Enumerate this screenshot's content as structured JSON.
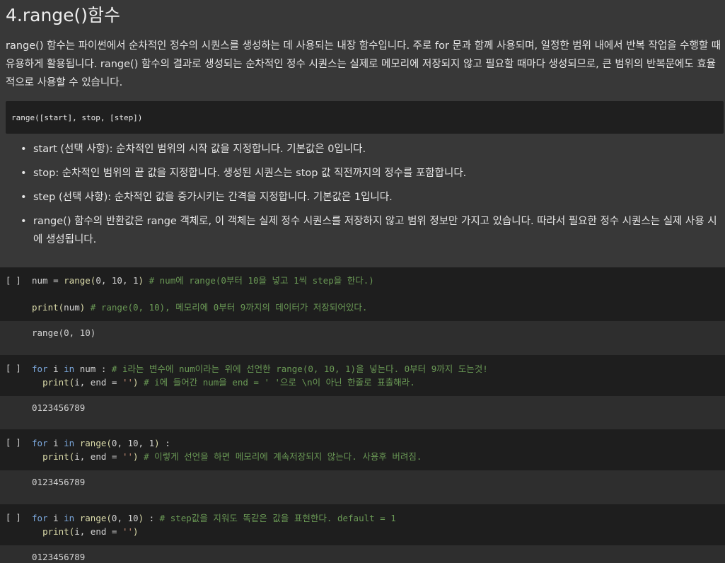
{
  "title": "4.range()함수",
  "intro": "range() 함수는 파이썬에서 순차적인 정수의 시퀀스를 생성하는 데 사용되는 내장 함수입니다. 주로 for 문과 함께 사용되며, 일정한 범위 내에서 반복 작업을 수행할 때 유용하게 활용됩니다. range() 함수의 결과로 생성되는 순차적인 정수 시퀀스는 실제로 메모리에 저장되지 않고 필요할 때마다 생성되므로, 큰 범위의 반복문에도 효율적으로 사용할 수 있습니다.",
  "syntax": "range([start], stop, [step])",
  "bullets": [
    "start (선택 사항): 순차적인 범위의 시작 값을 지정합니다. 기본값은 0입니다.",
    "stop: 순차적인 범위의 끝 값을 지정합니다. 생성된 시퀀스는 stop 값 직전까지의 정수를 포함합니다.",
    "step (선택 사항): 순차적인 값을 증가시키는 간격을 지정합니다. 기본값은 1입니다.",
    "range() 함수의 반환값은 range 객체로, 이 객체는 실제 정수 시퀀스를 저장하지 않고 범위 정보만 가지고 있습니다. 따라서 필요한 정수 시퀀스는 실제 사용 시에 생성됩니다."
  ],
  "cells": [
    {
      "prompt": "[ ]",
      "code": [
        [
          [
            "num = ",
            ""
          ],
          [
            "range",
            "fn"
          ],
          [
            "(",
            "fn"
          ],
          [
            "0, 10, 1",
            ""
          ],
          [
            ")",
            "fn"
          ],
          [
            " # num에 range(0부터 10을 넣고 1씩 step을 한다.)",
            "cm"
          ]
        ],
        [
          [
            "",
            ""
          ]
        ],
        [
          [
            "print",
            "fn"
          ],
          [
            "(",
            "fn"
          ],
          [
            "num",
            ""
          ],
          [
            ")",
            "fn"
          ],
          [
            " # range(0, 10), 메모리에 0부터 9까지의 데이터가 저장되어있다.",
            "cm"
          ]
        ]
      ],
      "output": "range(0, 10)"
    },
    {
      "prompt": "[ ]",
      "code": [
        [
          [
            "for",
            "kw"
          ],
          [
            " i ",
            ""
          ],
          [
            "in",
            "kw"
          ],
          [
            " num : ",
            ""
          ],
          [
            "# i라는 변수에 num이라는 위에 선언한 range(0, 10, 1)을 넣는다. 0부터 9까지 도는것!",
            "cm"
          ]
        ],
        [
          [
            "  ",
            ""
          ],
          [
            "print",
            "fn"
          ],
          [
            "(",
            "fn"
          ],
          [
            "i, end = ",
            ""
          ],
          [
            "''",
            "st"
          ],
          [
            ")",
            "fn"
          ],
          [
            " # i에 들어간 num을 end = ' '으로 \\n이 아닌 한줄로 표출해라.",
            "cm"
          ]
        ]
      ],
      "output": "0123456789"
    },
    {
      "prompt": "[ ]",
      "code": [
        [
          [
            "for",
            "kw"
          ],
          [
            " i ",
            ""
          ],
          [
            "in",
            "kw"
          ],
          [
            " ",
            ""
          ],
          [
            "range",
            "fn"
          ],
          [
            "(",
            "fn"
          ],
          [
            "0, 10, 1",
            ""
          ],
          [
            ")",
            "fn"
          ],
          [
            " :",
            ""
          ]
        ],
        [
          [
            "  ",
            ""
          ],
          [
            "print",
            "fn"
          ],
          [
            "(",
            "fn"
          ],
          [
            "i, end = ",
            ""
          ],
          [
            "''",
            "st"
          ],
          [
            ")",
            "fn"
          ],
          [
            " # 이렇게 선언을 하면 메모리에 계속저장되지 않는다. 사용후 버려짐.",
            "cm"
          ]
        ]
      ],
      "output": "0123456789"
    },
    {
      "prompt": "[ ]",
      "code": [
        [
          [
            "for",
            "kw"
          ],
          [
            " i ",
            ""
          ],
          [
            "in",
            "kw"
          ],
          [
            " ",
            ""
          ],
          [
            "range",
            "fn"
          ],
          [
            "(",
            "fn"
          ],
          [
            "0, 10",
            ""
          ],
          [
            ")",
            "fn"
          ],
          [
            " : ",
            ""
          ],
          [
            "# step값을 지워도 똑같은 값을 표현한다. default = 1",
            "cm"
          ]
        ],
        [
          [
            "  ",
            ""
          ],
          [
            "print",
            "fn"
          ],
          [
            "(",
            "fn"
          ],
          [
            "i, end = ",
            ""
          ],
          [
            "''",
            "st"
          ],
          [
            ")",
            "fn"
          ]
        ]
      ],
      "output": "0123456789"
    }
  ]
}
